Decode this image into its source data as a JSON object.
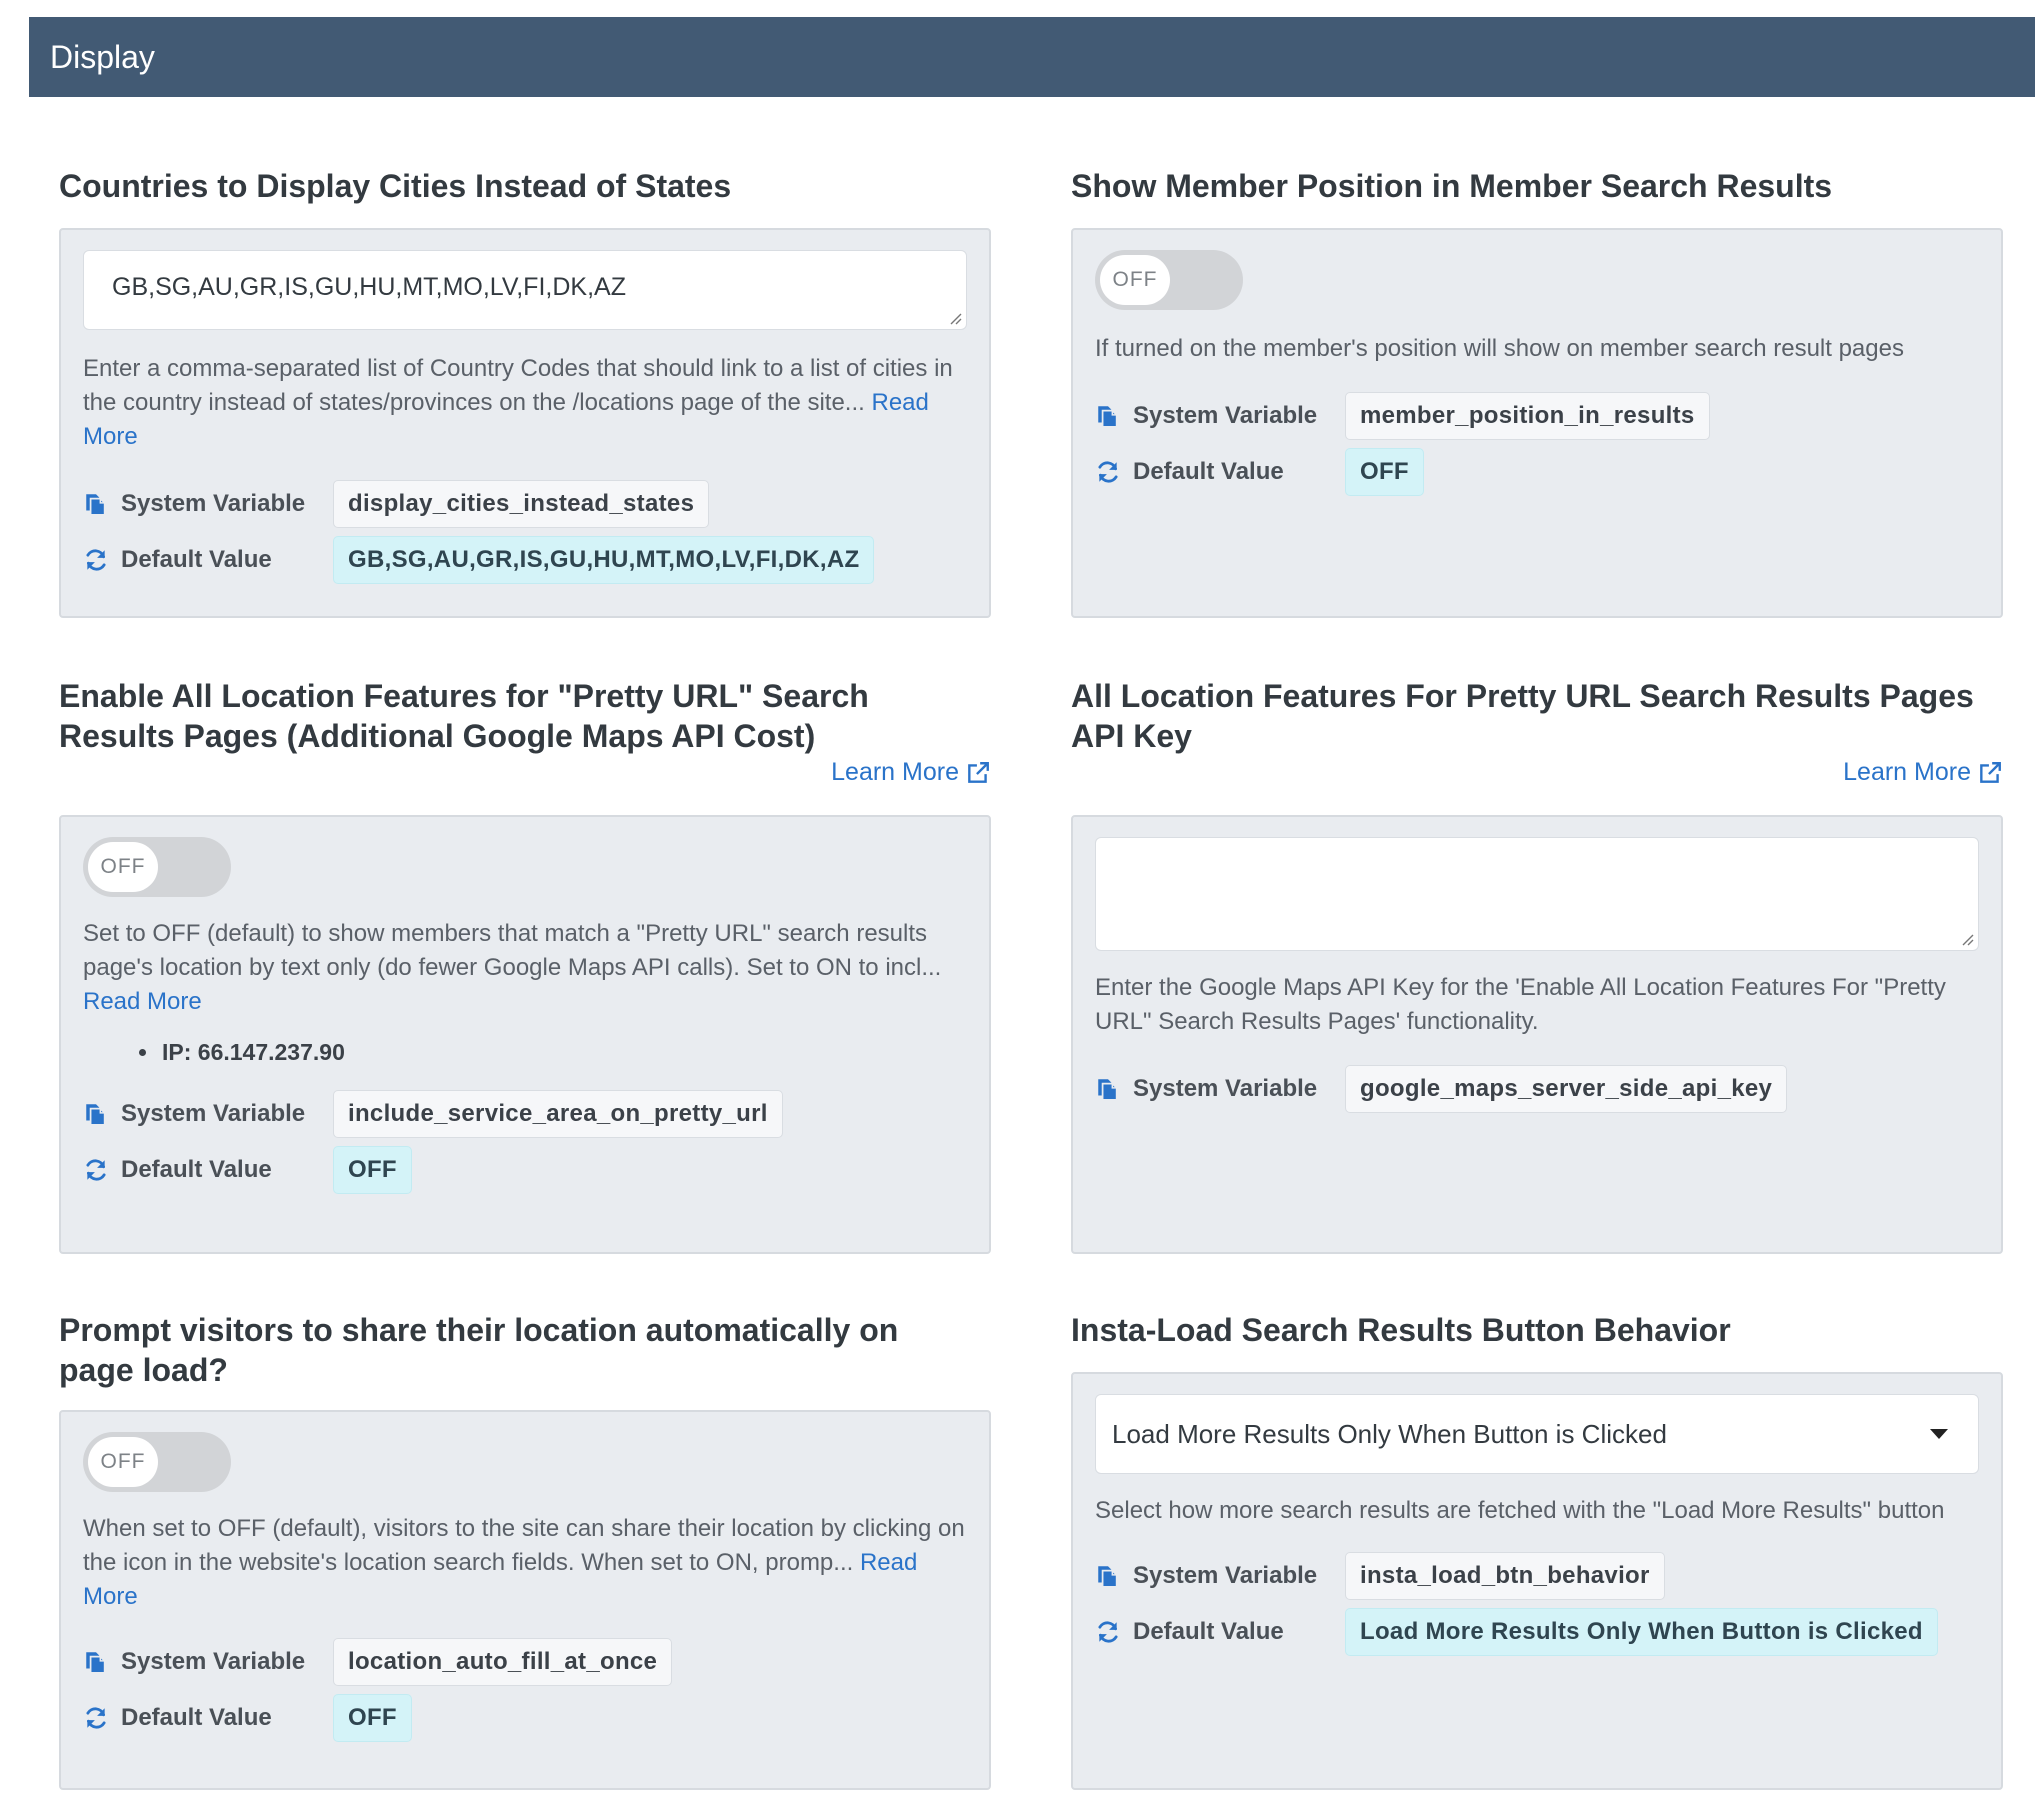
{
  "header": {
    "title": "Display"
  },
  "sections": {
    "countries": {
      "title": "Countries to Display Cities Instead of States",
      "value": "GB,SG,AU,GR,IS,GU,HU,MT,MO,LV,FI,DK,AZ",
      "desc": "Enter a comma-separated list of Country Codes that should link to a list of cities in the country instead of states/provinces on the /locations page of the site... ",
      "read_more": "Read More",
      "system_variable_label": "System Variable",
      "system_variable": "display_cities_instead_states",
      "default_value_label": "Default Value",
      "default_value": "GB,SG,AU,GR,IS,GU,HU,MT,MO,LV,FI,DK,AZ"
    },
    "member_position": {
      "title": "Show Member Position in Member Search Results",
      "toggle": "OFF",
      "desc": "If turned on the member's position will show on member search result pages",
      "system_variable_label": "System Variable",
      "system_variable": "member_position_in_results",
      "default_value_label": "Default Value",
      "default_value": "OFF"
    },
    "pretty_url": {
      "title_line1": "Enable All Location Features for \"Pretty URL\" Search",
      "title_line2": "Results Pages (Additional Google Maps API Cost)",
      "learn_more": "Learn More",
      "toggle": "OFF",
      "desc": "Set to OFF (default) to show members that match a \"Pretty URL\" search results page's location by text only (do fewer Google Maps API calls). Set to ON to incl... ",
      "read_more": "Read More",
      "ip": "IP: 66.147.237.90",
      "system_variable_label": "System Variable",
      "system_variable": "include_service_area_on_pretty_url",
      "default_value_label": "Default Value",
      "default_value": "OFF"
    },
    "api_key": {
      "title_line1": "All Location Features For Pretty URL Search Results Pages",
      "title_line2": "API Key",
      "learn_more": "Learn More",
      "value": "",
      "desc": "Enter the Google Maps API Key for the 'Enable All Location Features For \"Pretty URL\" Search Results Pages' functionality.",
      "system_variable_label": "System Variable",
      "system_variable": "google_maps_server_side_api_key"
    },
    "prompt_location": {
      "title_line1": "Prompt visitors to share their location automatically on",
      "title_line2": "page load?",
      "toggle": "OFF",
      "desc": "When set to OFF (default), visitors to the site can share their location by clicking on the icon in the website's location search fields.  When set to ON, promp... ",
      "read_more": "Read More",
      "system_variable_label": "System Variable",
      "system_variable": "location_auto_fill_at_once",
      "default_value_label": "Default Value",
      "default_value": "OFF"
    },
    "insta_load": {
      "title": "Insta-Load Search Results Button Behavior",
      "selected": "Load More Results Only When Button is Clicked",
      "desc": "Select how more search results are fetched with the \"Load More Results\" button",
      "system_variable_label": "System Variable",
      "system_variable": "insta_load_btn_behavior",
      "default_value_label": "Default Value",
      "default_value": "Load More Results Only When Button is Clicked"
    }
  },
  "icons": {
    "system_variable": "copy-icon",
    "default_value": "refresh-icon",
    "learn_more": "external-link-icon"
  },
  "colors": {
    "header_bg": "#425a74",
    "link": "#2a73c9",
    "card_bg": "#e9ecf0",
    "default_value_bg": "#d4f3f8"
  }
}
